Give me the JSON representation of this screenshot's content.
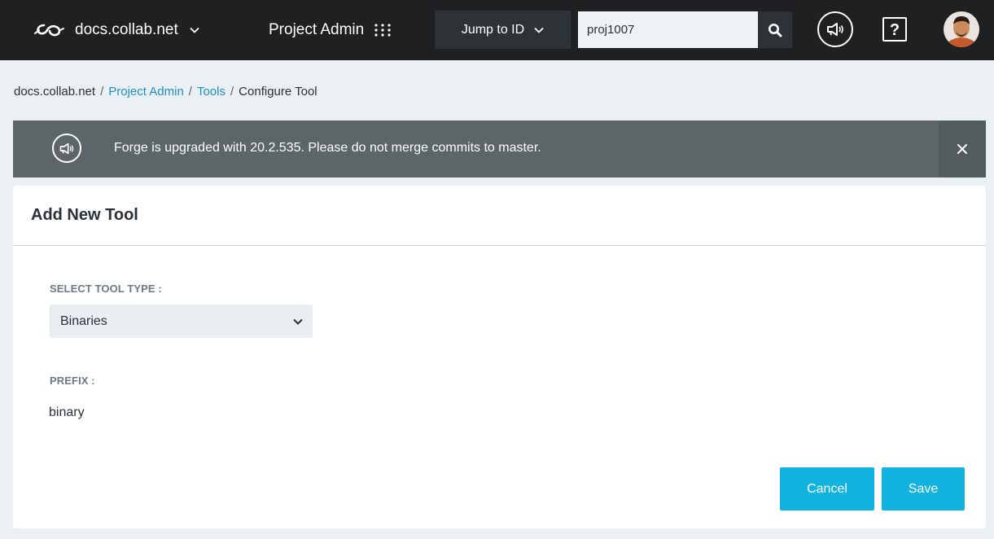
{
  "topbar": {
    "site_name": "docs.collab.net",
    "project_menu": "Project Admin",
    "jump_label": "Jump to ID",
    "search": {
      "value": "proj1007"
    },
    "help_glyph": "?"
  },
  "breadcrumb": {
    "items": [
      "docs.collab.net",
      "Project Admin",
      "Tools",
      "Configure Tool"
    ],
    "separator": "/"
  },
  "banner": {
    "message": "Forge is upgraded with 20.2.535. Please do not merge commits to master.",
    "close_glyph": "×"
  },
  "card": {
    "title": "Add New Tool",
    "tool_type_label": "SELECT TOOL TYPE :",
    "tool_type_value": "Binaries",
    "prefix_label": "PREFIX :",
    "prefix_value": "binary",
    "cancel_label": "Cancel",
    "save_label": "Save"
  },
  "colors": {
    "topbar_bg": "#1e2022",
    "accent_button": "#12b3df",
    "link": "#1d8fc9",
    "banner_bg": "#5c6669"
  },
  "icons": [
    "collabnet-logo-icon",
    "chevron-down-icon",
    "grid-dots-icon",
    "search-icon",
    "megaphone-icon",
    "help-icon",
    "close-icon"
  ]
}
